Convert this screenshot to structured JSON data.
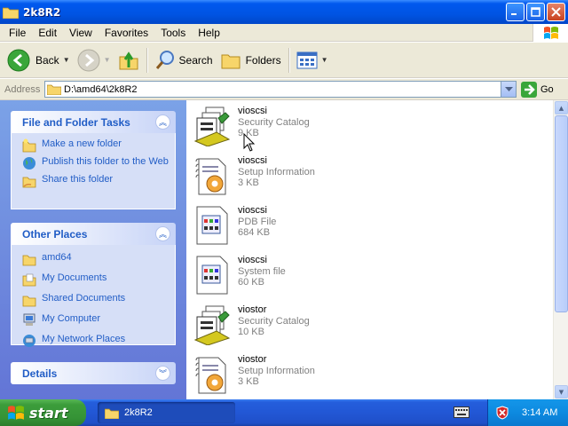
{
  "window": {
    "title": "2k8R2"
  },
  "menu": {
    "items": [
      "File",
      "Edit",
      "View",
      "Favorites",
      "Tools",
      "Help"
    ]
  },
  "toolbar": {
    "back_label": "Back",
    "search_label": "Search",
    "folders_label": "Folders"
  },
  "address": {
    "label": "Address",
    "path": "D:\\amd64\\2k8R2",
    "go_label": "Go"
  },
  "tasks_panel": {
    "title": "File and Folder Tasks",
    "items": [
      "Make a new folder",
      "Publish this folder to the Web",
      "Share this folder"
    ]
  },
  "places_panel": {
    "title": "Other Places",
    "items": [
      "amd64",
      "My Documents",
      "Shared Documents",
      "My Computer",
      "My Network Places"
    ]
  },
  "details_panel": {
    "title": "Details"
  },
  "files": [
    {
      "name": "vioscsi",
      "type": "Security Catalog",
      "size": "9 KB",
      "icon": "security-catalog-icon"
    },
    {
      "name": "vioscsi",
      "type": "Setup Information",
      "size": "3 KB",
      "icon": "setup-information-icon"
    },
    {
      "name": "vioscsi",
      "type": "PDB File",
      "size": "684 KB",
      "icon": "pdb-file-icon"
    },
    {
      "name": "vioscsi",
      "type": "System file",
      "size": "60 KB",
      "icon": "system-file-icon"
    },
    {
      "name": "viostor",
      "type": "Security Catalog",
      "size": "10 KB",
      "icon": "security-catalog-icon"
    },
    {
      "name": "viostor",
      "type": "Setup Information",
      "size": "3 KB",
      "icon": "setup-information-icon"
    }
  ],
  "taskbar": {
    "start_label": "start",
    "task_label": "2k8R2",
    "clock": "3:14 AM"
  },
  "colors": {
    "titlebar": "#0054e3",
    "panel_link": "#215dc6",
    "start_green": "#3c9d3b",
    "taskbar_blue": "#245edc"
  }
}
